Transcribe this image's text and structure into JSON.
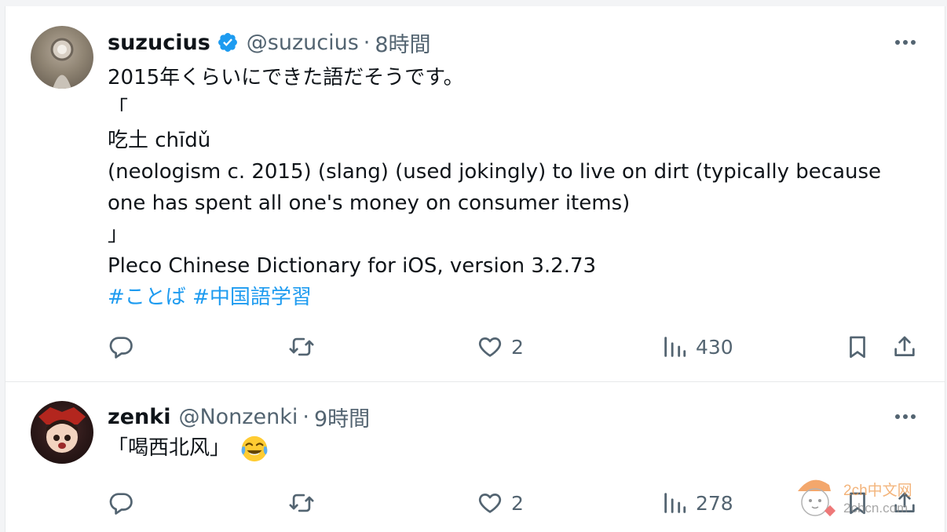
{
  "colors": {
    "accent": "#1d9bf0",
    "secondary": "#536471",
    "text": "#0f1419",
    "divider": "#e7e9ea"
  },
  "posts": [
    {
      "name": "suzucius",
      "verified": true,
      "handle": "@suzucius",
      "separator": "·",
      "time": "8時間",
      "lines": [
        "2015年くらいにできた語だそうです。",
        "「",
        "吃土 chīdǔ",
        "(neologism c. 2015) (slang) (used jokingly) to live on dirt (typically because",
        "one has spent all one's money on consumer items)",
        "」",
        "Pleco Chinese Dictionary for iOS, version 3.2.73"
      ],
      "hashtags": "#ことば #中国語学習",
      "stats": {
        "replies": "",
        "reposts": "",
        "likes": "2",
        "views": "430"
      }
    },
    {
      "name": "zenki",
      "verified": false,
      "handle": "@Nonzenki",
      "separator": "·",
      "time": "9時間",
      "text": "「喝西北风」",
      "emoji": "face-with-tears-of-joy",
      "stats": {
        "replies": "",
        "reposts": "",
        "likes": "2",
        "views": "278"
      }
    }
  ],
  "watermark": {
    "line1": "2ch中文网",
    "line2": "2chcn.com"
  }
}
